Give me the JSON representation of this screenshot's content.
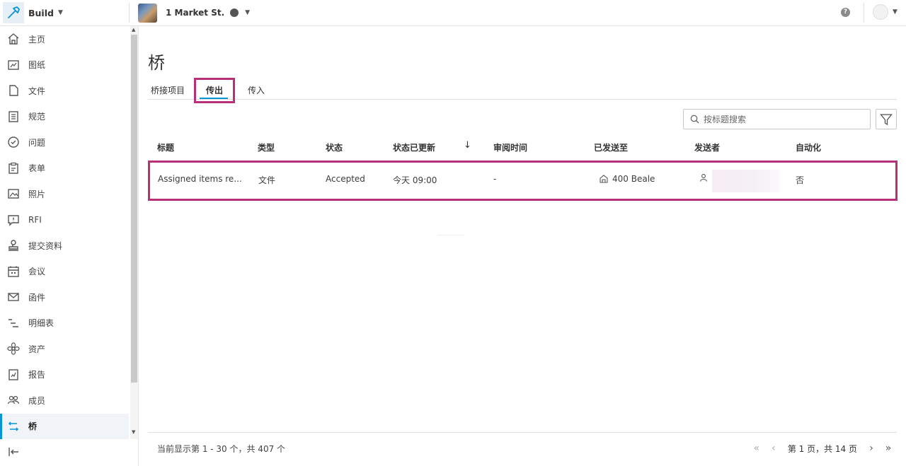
{
  "app": {
    "name": "Build"
  },
  "project": {
    "name": "1 Market St."
  },
  "sidebar": {
    "items": [
      {
        "label": "主页",
        "icon": "home-icon"
      },
      {
        "label": "图纸",
        "icon": "sheets-icon"
      },
      {
        "label": "文件",
        "icon": "file-icon"
      },
      {
        "label": "规范",
        "icon": "specs-icon"
      },
      {
        "label": "问题",
        "icon": "issues-icon"
      },
      {
        "label": "表单",
        "icon": "forms-icon"
      },
      {
        "label": "照片",
        "icon": "photos-icon"
      },
      {
        "label": "RFI",
        "icon": "rfi-icon"
      },
      {
        "label": "提交资料",
        "icon": "submittals-icon"
      },
      {
        "label": "会议",
        "icon": "meetings-icon"
      },
      {
        "label": "函件",
        "icon": "correspondence-icon"
      },
      {
        "label": "明细表",
        "icon": "schedule-icon"
      },
      {
        "label": "资产",
        "icon": "assets-icon"
      },
      {
        "label": "报告",
        "icon": "reports-icon"
      },
      {
        "label": "成员",
        "icon": "members-icon"
      },
      {
        "label": "桥",
        "icon": "bridge-icon",
        "active": true
      }
    ]
  },
  "page": {
    "title": "桥",
    "tabs": [
      {
        "label": "桥接项目"
      },
      {
        "label": "传出",
        "active": true
      },
      {
        "label": "传入"
      }
    ]
  },
  "search": {
    "placeholder": "按标题搜索"
  },
  "table": {
    "columns": [
      "标题",
      "类型",
      "状态",
      "状态已更新",
      "审阅时间",
      "已发送至",
      "发送者",
      "自动化"
    ],
    "rows": [
      {
        "title": "Assigned items re...",
        "type": "文件",
        "status": "Accepted",
        "status_updated": "今天 09:00",
        "review_time": "-",
        "sent_to": "400 Beale",
        "sender": "",
        "automation": "否"
      }
    ]
  },
  "footer": {
    "summary": "当前显示第 1 - 30 个，共 407 个",
    "page_info": "第 1 页，共 14 页"
  },
  "colors": {
    "accent": "#0696d7",
    "highlight": "#b8307a"
  }
}
